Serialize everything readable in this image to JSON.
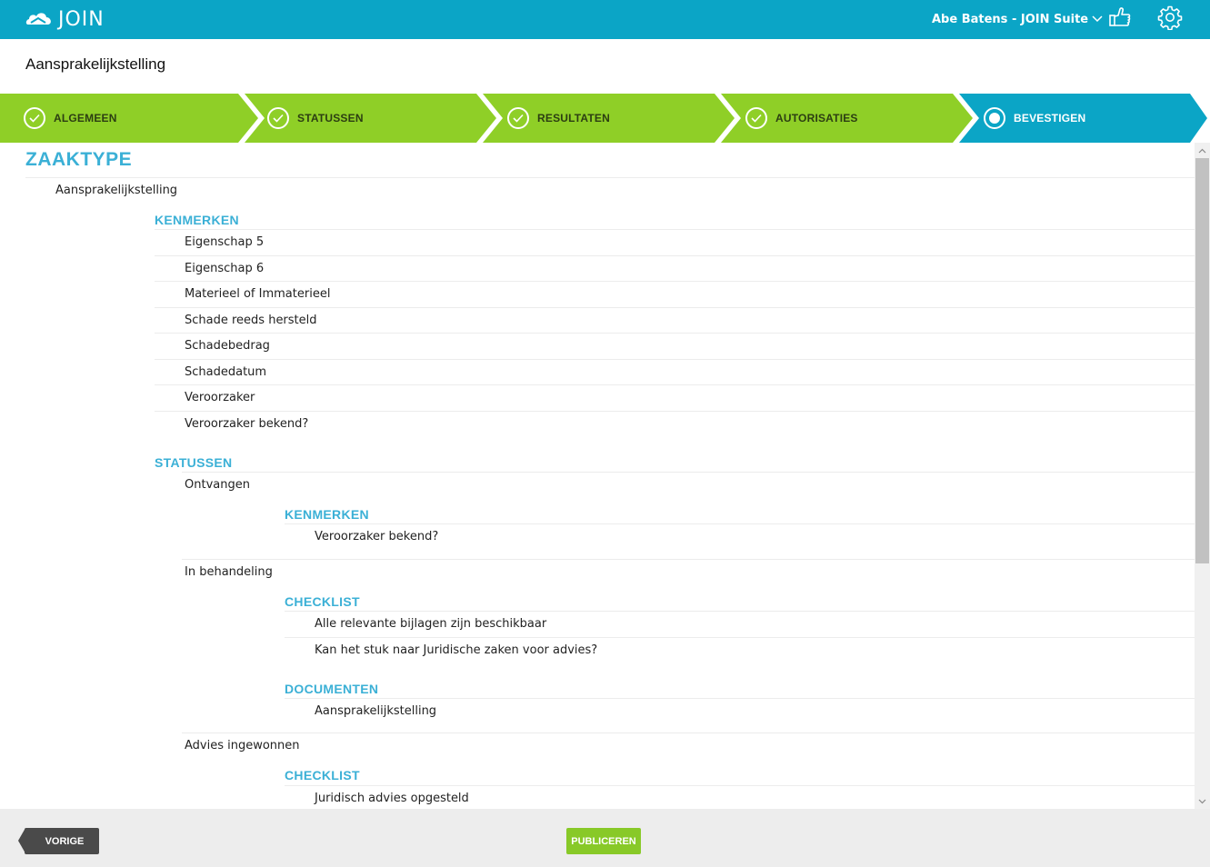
{
  "app": {
    "logo_text": "JOIN",
    "user_menu": "Abe Batens - JOIN Suite"
  },
  "page": {
    "title": "Aansprakelijkstelling"
  },
  "wizard": {
    "steps": [
      {
        "label": "ALGEMEEN",
        "state": "done"
      },
      {
        "label": "STATUSSEN",
        "state": "done"
      },
      {
        "label": "RESULTATEN",
        "state": "done"
      },
      {
        "label": "AUTORISATIES",
        "state": "done"
      },
      {
        "label": "BEVESTIGEN",
        "state": "active"
      }
    ],
    "colors": {
      "done": "#8fcf27",
      "active": "#0ba5c6"
    }
  },
  "content": {
    "title": "ZAAKTYPE",
    "zaaktype_name": "Aansprakelijkstelling",
    "kenmerken": {
      "heading": "KENMERKEN",
      "items": [
        "Eigenschap 5",
        "Eigenschap 6",
        "Materieel of Immaterieel",
        "Schade reeds hersteld",
        "Schadebedrag",
        "Schadedatum",
        "Veroorzaker",
        "Veroorzaker bekend?"
      ]
    },
    "statussen": {
      "heading": "STATUSSEN",
      "items": [
        {
          "name": "Ontvangen",
          "kenmerken_heading": "KENMERKEN",
          "kenmerken": [
            "Veroorzaker bekend?"
          ]
        },
        {
          "name": "In behandeling",
          "checklist_heading": "CHECKLIST",
          "checklist": [
            "Alle relevante bijlagen zijn beschikbaar",
            "Kan het stuk naar Juridische zaken voor advies?"
          ],
          "documenten_heading": "DOCUMENTEN",
          "documenten": [
            "Aansprakelijkstelling"
          ]
        },
        {
          "name": "Advies ingewonnen",
          "checklist_heading": "CHECKLIST",
          "checklist": [
            "Juridisch advies opgesteld"
          ]
        }
      ]
    }
  },
  "footer": {
    "prev_label": "VORIGE",
    "publish_label": "PUBLICEREN"
  }
}
